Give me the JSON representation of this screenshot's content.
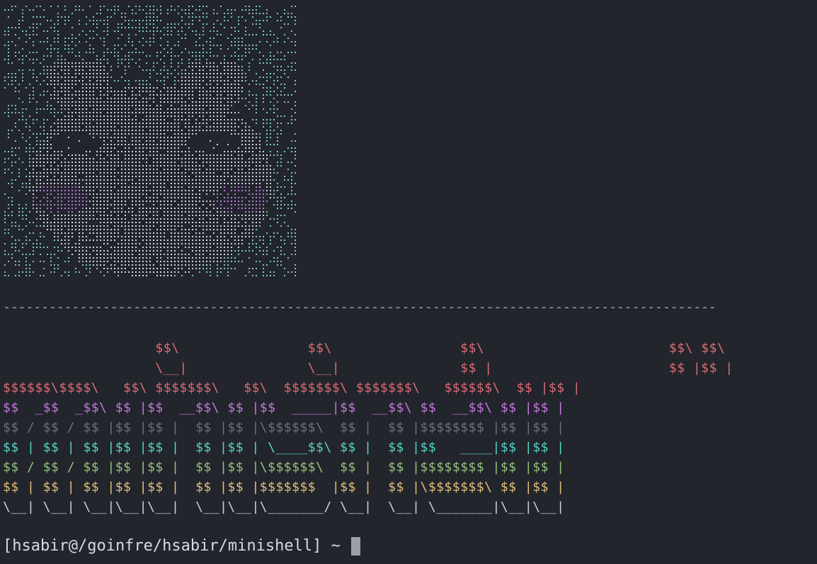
{
  "art": {
    "name": "braille-cat-face",
    "colors": {
      "base": "#7fc7c2",
      "face": "#cdd5dc",
      "blush": "#b77ed6"
    }
  },
  "divider": "---------------------------------------------------------------------------------------------",
  "banner": {
    "lines": [
      {
        "text": "                   $$\\                $$\\                $$\\                       $$\\ $$\\ ",
        "color": "#e06c75"
      },
      {
        "text": "                   \\__|               \\__|               $$ |                      $$ |$$ |",
        "color": "#e06c75"
      },
      {
        "text": "$$$$$$\\$$$$\\   $$\\ $$$$$$$\\   $$\\  $$$$$$$\\ $$$$$$$\\   $$$$$$\\  $$ |$$ |",
        "color": "#e06c75"
      },
      {
        "text": "$$  _$$  _$$\\ $$ |$$  __$$\\ $$ |$$  _____|$$  __$$\\ $$  __$$\\ $$ |$$ |",
        "color": "#c678dd"
      },
      {
        "text": "$$ / $$ / $$ |$$ |$$ |  $$ |$$ |\\$$$$$$\\  $$ |  $$ |$$$$$$$$ |$$ |$$ |",
        "color": "#6b717d"
      },
      {
        "text": "$$ | $$ | $$ |$$ |$$ |  $$ |$$ | \\____$$\\ $$ |  $$ |$$   ____|$$ |$$ |",
        "color": "#56d6c8"
      },
      {
        "text": "$$ / $$ / $$ |$$ |$$ |  $$ |$$ |\\$$$$$$\\  $$ |  $$ |$$$$$$$$ |$$ |$$ |",
        "color": "#98c379"
      },
      {
        "text": "$$ | $$ | $$ |$$ |$$ |  $$ |$$ |$$$$$$$  |$$ |  $$ |\\$$$$$$$\\ $$ |$$ |",
        "color": "#e5c07b"
      },
      {
        "text": "\\__| \\__| \\__|\\__|\\__|  \\__|\\__|\\_______/ \\__|  \\__| \\_______|\\__|\\__|",
        "color": "#cfd2d8"
      }
    ]
  },
  "prompt": {
    "text": "[hsabir@/goinfre/hsabir/minishell] ~ "
  }
}
